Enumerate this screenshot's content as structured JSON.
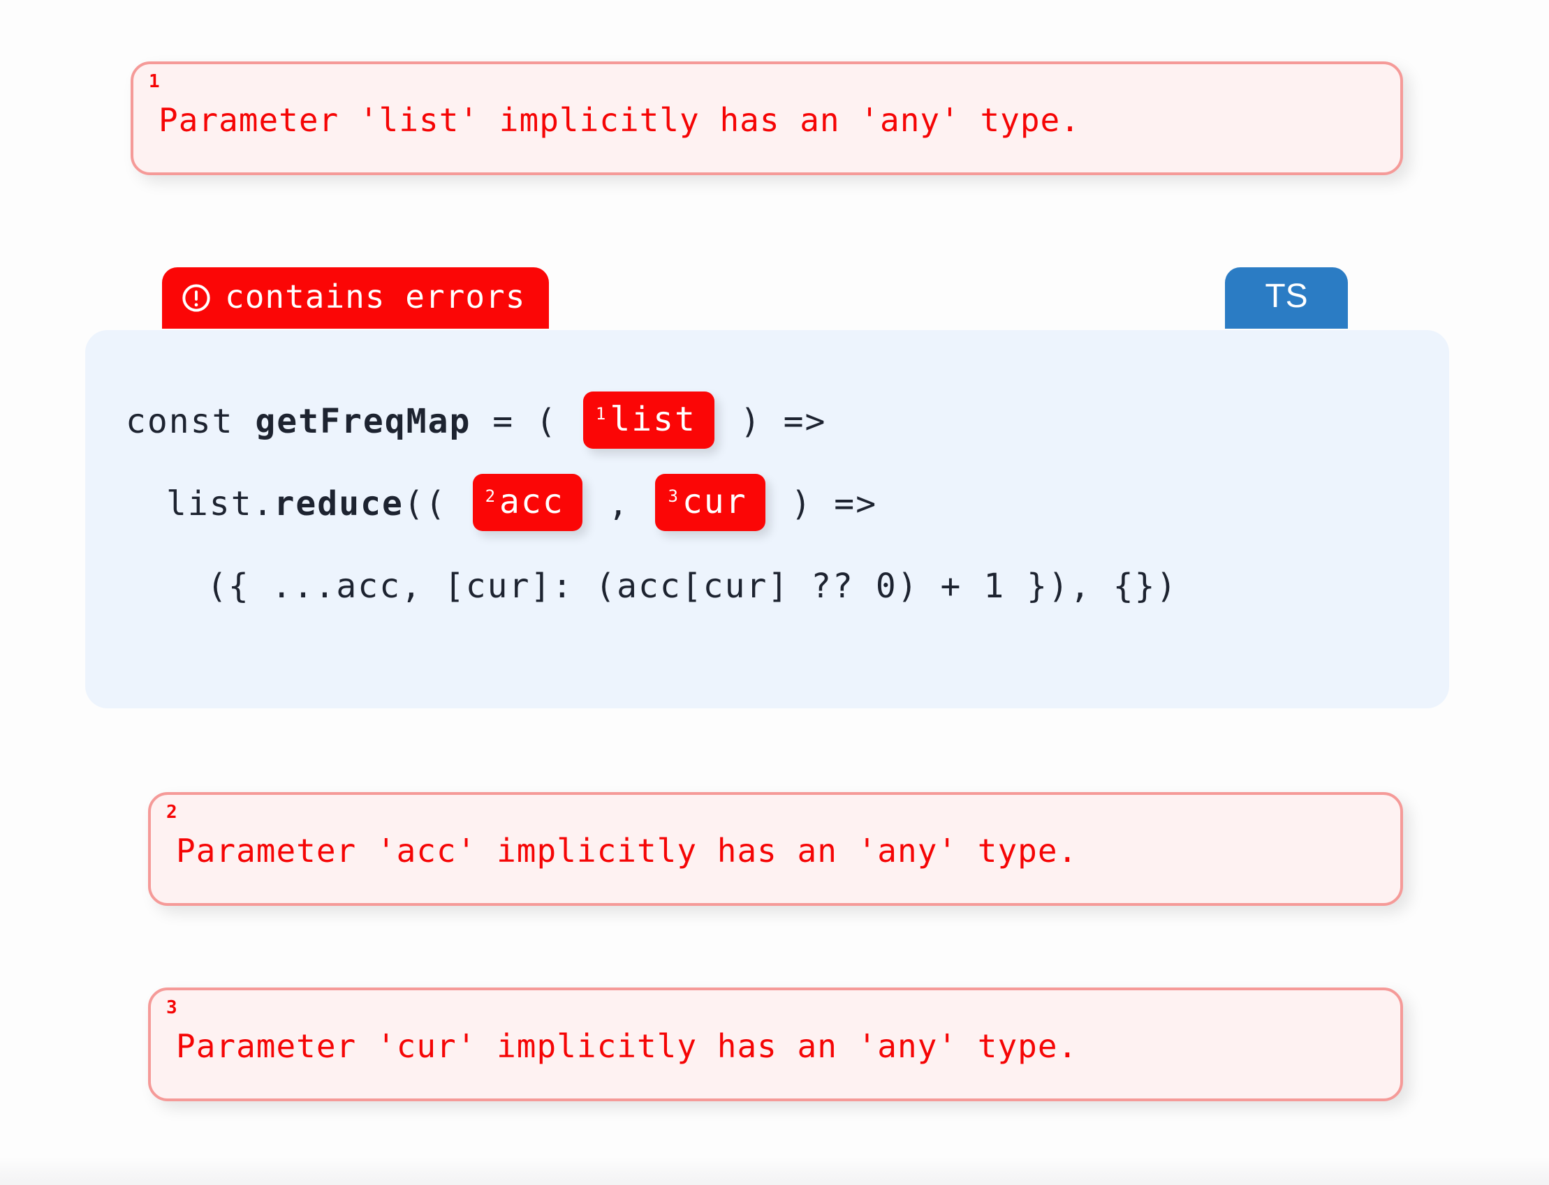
{
  "page": {
    "background_color": "#fdfdfd",
    "language_badge": {
      "label": "TS",
      "color": "#2b7cc4"
    },
    "status_badge": {
      "label": "contains errors",
      "icon": "alert-circle-icon",
      "color": "#fb0606"
    }
  },
  "code": {
    "background_color": "#edf4fd",
    "lines": [
      {
        "indent": 0,
        "segments": [
          {
            "type": "plain",
            "text": "const "
          },
          {
            "type": "bold",
            "text": "getFreqMap"
          },
          {
            "type": "plain",
            "text": " = ( "
          },
          {
            "type": "highlight",
            "marker": "1",
            "text": "list"
          },
          {
            "type": "plain",
            "text": " ) =>"
          }
        ]
      },
      {
        "indent": 1,
        "segments": [
          {
            "type": "plain",
            "text": "list."
          },
          {
            "type": "bold",
            "text": "reduce"
          },
          {
            "type": "plain",
            "text": "(( "
          },
          {
            "type": "highlight",
            "marker": "2",
            "text": "acc"
          },
          {
            "type": "plain",
            "text": " , "
          },
          {
            "type": "highlight",
            "marker": "3",
            "text": "cur"
          },
          {
            "type": "plain",
            "text": " ) =>"
          }
        ]
      },
      {
        "indent": 2,
        "segments": [
          {
            "type": "plain",
            "text": "({ ...acc, [cur]: (acc[cur] ?? 0) + 1 }), {})"
          }
        ]
      }
    ]
  },
  "diagnostics": [
    {
      "marker": "1",
      "message": "Parameter 'list' implicitly has an 'any' type."
    },
    {
      "marker": "2",
      "message": "Parameter 'acc' implicitly has an 'any' type."
    },
    {
      "marker": "3",
      "message": "Parameter 'cur' implicitly has an 'any' type."
    }
  ],
  "colors": {
    "error_red": "#f50505",
    "error_box_fill": "#fef2f2",
    "error_box_border": "#f59a98",
    "highlight_red": "#fb0606",
    "ts_blue": "#2b7cc4",
    "code_bg": "#edf4fd",
    "code_text": "#1d2330"
  }
}
